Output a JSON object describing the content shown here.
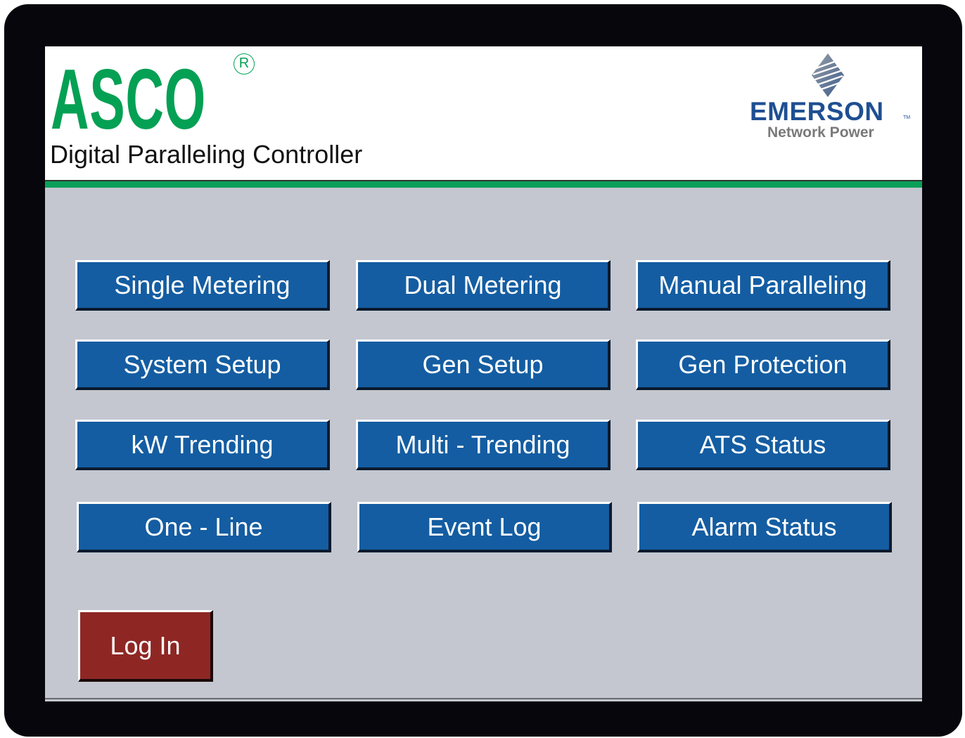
{
  "header": {
    "brand": "ASCO",
    "registered_mark": "R",
    "product_title": "Digital Paralleling Controller",
    "partner_name": "EMERSON",
    "partner_tm": "TM",
    "partner_subtitle": "Network Power"
  },
  "menu": {
    "buttons": [
      {
        "label": "Single Metering"
      },
      {
        "label": "Dual Metering"
      },
      {
        "label": "Manual Paralleling"
      },
      {
        "label": "System Setup"
      },
      {
        "label": "Gen Setup"
      },
      {
        "label": "Gen Protection"
      },
      {
        "label": "kW Trending"
      },
      {
        "label": "Multi - Trending"
      },
      {
        "label": "ATS Status"
      },
      {
        "label": "One - Line"
      },
      {
        "label": "Event Log"
      },
      {
        "label": "Alarm Status"
      }
    ]
  },
  "login": {
    "label": "Log In"
  },
  "colors": {
    "brand_green": "#04a054",
    "button_blue": "#145da2",
    "login_red": "#8e2724",
    "screen_gray": "#c4c7cf",
    "emerson_blue": "#1f4f92"
  },
  "icons": {
    "emerson_logo": "emerson-diamond-icon",
    "registered": "registered-mark-icon"
  }
}
